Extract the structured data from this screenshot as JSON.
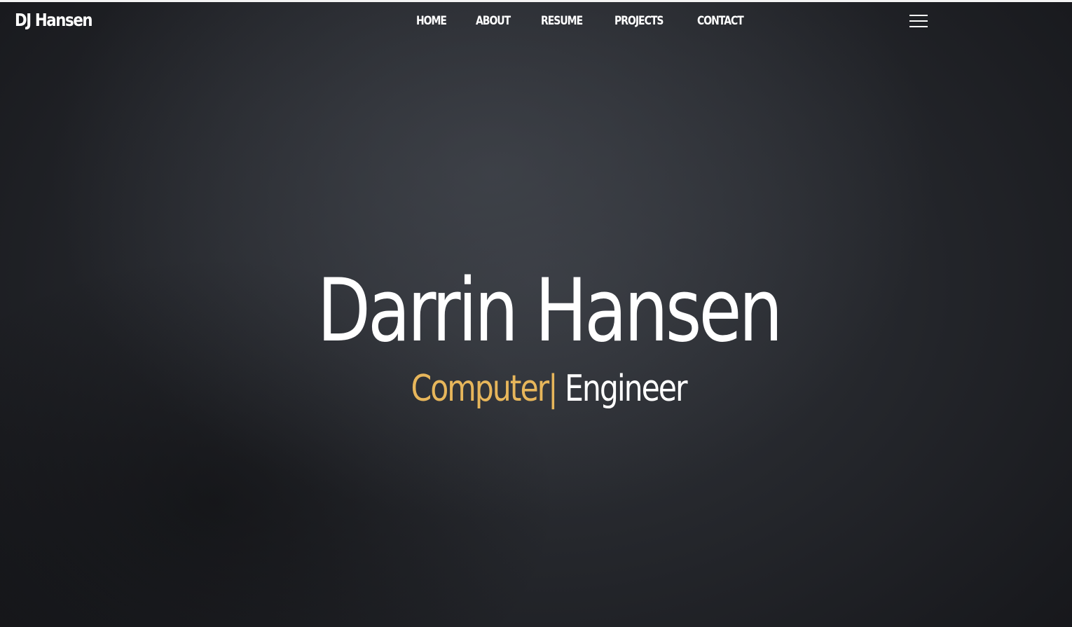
{
  "header": {
    "brand": "DJ Hansen",
    "nav": [
      {
        "label": "HOME"
      },
      {
        "label": "ABOUT"
      },
      {
        "label": "RESUME"
      },
      {
        "label": "PROJECTS"
      },
      {
        "label": "CONTACT"
      }
    ],
    "menu_icon": "hamburger-menu-icon"
  },
  "hero": {
    "name": "Darrin Hansen",
    "typed_word": "Computer",
    "cursor": "|",
    "static_word": "Engineer"
  },
  "colors": {
    "accent": "#e7b65b",
    "text": "#ffffff",
    "background": "#24262b"
  }
}
